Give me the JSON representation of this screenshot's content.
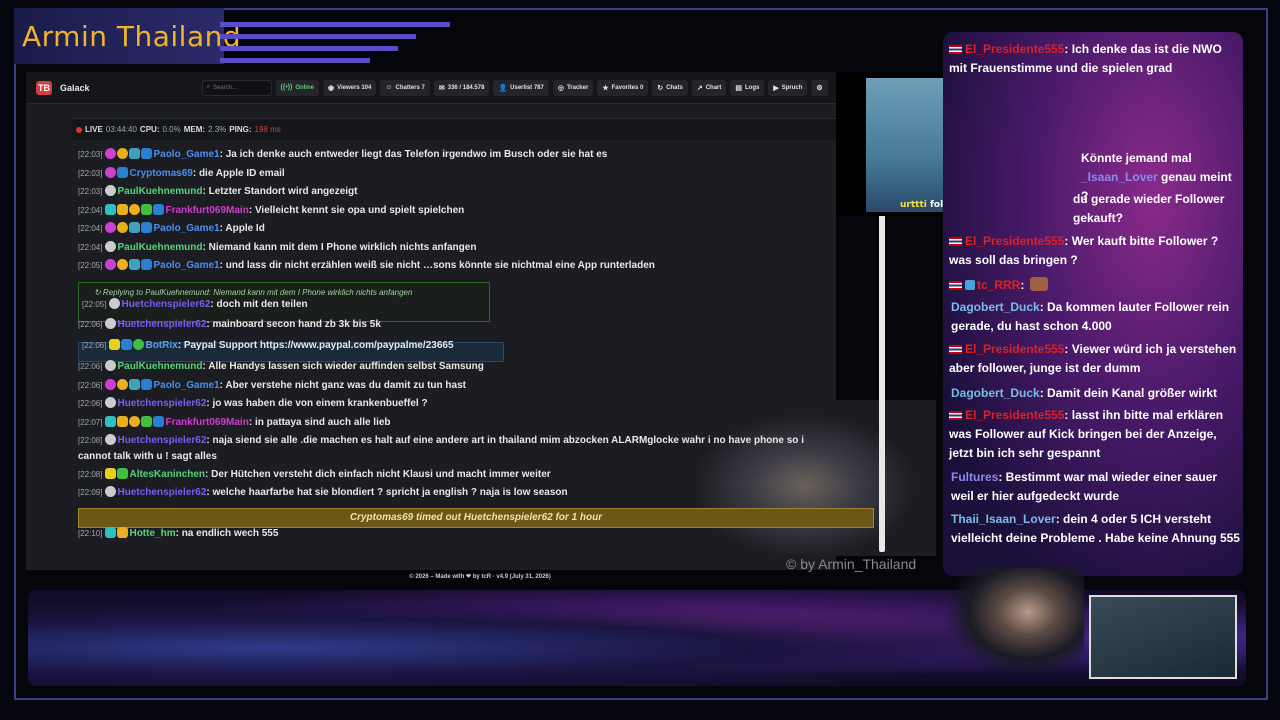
{
  "overlay": {
    "title": "Armin Thailand",
    "watermark": "© by Armin_Thailand",
    "footer": "© 2026 – Made with ❤ by tcR · v4.9 (July 31, 2026)"
  },
  "app": {
    "logo": "TB",
    "name": "Galack",
    "search_placeholder": "Search...",
    "nav": [
      {
        "icon": "online-icon",
        "glyph": "((•))",
        "label": "Online"
      },
      {
        "icon": "eye-icon",
        "glyph": "◉",
        "label": "Viewers 104"
      },
      {
        "icon": "chatters-icon",
        "glyph": "☺",
        "label": "Chatters 7"
      },
      {
        "icon": "message-icon",
        "glyph": "✉",
        "label": "336 / 184.578"
      },
      {
        "icon": "user-icon",
        "glyph": "👤",
        "label": "Userlist 787"
      },
      {
        "icon": "tracker-icon",
        "glyph": "◎",
        "label": "Tracker"
      },
      {
        "icon": "star-icon",
        "glyph": "★",
        "label": "Favorites 0"
      },
      {
        "icon": "history-icon",
        "glyph": "↻",
        "label": "Chats"
      },
      {
        "icon": "chart-icon",
        "glyph": "↗",
        "label": "Chart"
      },
      {
        "icon": "logs-icon",
        "glyph": "▤",
        "label": "Logs"
      },
      {
        "icon": "spruch-icon",
        "glyph": "▶",
        "label": "Spruch"
      },
      {
        "icon": "gear-icon",
        "glyph": "⚙",
        "label": ""
      }
    ],
    "status": {
      "live": "LIVE",
      "uptime": "03:44:40",
      "cpu_label": "CPU:",
      "cpu": "0.0%",
      "mem_label": "MEM:",
      "mem": "2.3%",
      "ping_label": "PING:",
      "ping": "198 ms"
    }
  },
  "chat": [
    {
      "time": "[22:03]",
      "user": "Paolo_Game1",
      "text": "Ja ich denke auch entweder liegt das Telefon irgendwo im Busch oder sie hat es"
    },
    {
      "time": "[22:03]",
      "user": "Cryptomas69",
      "text": "die Apple ID email"
    },
    {
      "time": "[22:03]",
      "user": "PaulKuehnemund",
      "text": "Letzter Standort wird angezeigt"
    },
    {
      "time": "[22:04]",
      "user": "Frankfurt069Main",
      "text": "Vielleicht kennt sie opa und spielt spielchen"
    },
    {
      "time": "[22:04]",
      "user": "Paolo_Game1",
      "text": "Apple Id"
    },
    {
      "time": "[22:04]",
      "user": "PaulKuehnemund",
      "text": "Niemand kann mit dem I Phone wirklich nichts anfangen"
    },
    {
      "time": "[22:05]",
      "user": "Paolo_Game1",
      "text": "und lass dir nicht erzählen weiß sie nicht …sons könnte sie nichtmal eine App runterladen"
    },
    {
      "reply": "Replying to PaulKuehnemund: Niemand kann mit dem I Phone wirklich nichts anfangen"
    },
    {
      "time": "[22:05]",
      "user": "Huetchenspieler62",
      "text": "doch mit den teilen"
    },
    {
      "time": "[22:06]",
      "user": "Huetchenspieler62",
      "text": "mainboard secon hand zb 3k bis 5k"
    },
    {
      "time": "[22:06]",
      "user": "BotRix",
      "text": "Paypal Support https://www.paypal.com/paypalme/23665"
    },
    {
      "time": "[22:06]",
      "user": "PaulKuehnemund",
      "text": "Alle Handys lassen sich wieder auffinden selbst Samsung"
    },
    {
      "time": "[22:06]",
      "user": "Paolo_Game1",
      "text": "Aber verstehe nicht ganz was du damit zu tun hast"
    },
    {
      "time": "[22:06]",
      "user": "Huetchenspieler62",
      "text": "jo was haben die von einem krankenbueffel ?"
    },
    {
      "time": "[22:07]",
      "user": "Frankfurt069Main",
      "text": "in pattaya sind auch alle lieb"
    },
    {
      "time": "[22:08]",
      "user": "Huetchenspieler62",
      "text": "naja siend sie alle .die machen es halt auf eine andere art in thailand mim abzocken ALARMglocke wahr i no have phone so i",
      "text2": "cannot talk with u ! sagt alles"
    },
    {
      "time": "[22:08]",
      "user": "AltesKaninchen",
      "text": "Der Hütchen versteht dich einfach nicht Klausi und macht immer weiter"
    },
    {
      "time": "[22:09]",
      "user": "Huetchenspieler62",
      "text": "welche haarfarbe hat sie blondiert ? spricht ja english ? naja is low season"
    },
    {
      "notice": "Cryptomas69 timed out Huetchenspieler62 for 1 hour"
    },
    {
      "time": "[22:10]",
      "user": "Hotte_hm",
      "text": "na endlich wech 555"
    }
  ],
  "video": {
    "caption_user": "urttti",
    "caption_text": " folgt dem Kanal!"
  },
  "side_chat": [
    {
      "user": "El_Presidente555",
      "text": ": Ich denke das ist die NWO mit Frauenstimme und die spielen grad"
    },
    {
      "user": "",
      "text": "Könnte jemand mal"
    },
    {
      "user": "_Isaan_Lover",
      "text": " genau meint ?"
    },
    {
      "user": "",
      "text": "du gerade wieder Follower gekauft?"
    },
    {
      "user": "El_Presidente555",
      "text": ": Wer kauft bitte Follower ? was soll das bringen ?"
    },
    {
      "user": "tc_RRR",
      "text": ":"
    },
    {
      "user": "Dagobert_Duck",
      "text": ": Da kommen lauter Follower rein gerade, du hast schon 4.000"
    },
    {
      "user": "El_Presidente555",
      "text": ": Viewer würd ich ja verstehen aber follower, junge ist der dumm"
    },
    {
      "user": "Dagobert_Duck",
      "text": ": Damit dein Kanal größer wirkt"
    },
    {
      "user": "El_Presidente555",
      "text": ": lasst ihn bitte mal erklären was Follower auf Kick bringen bei der Anzeige, jetzt bin ich sehr gespannt"
    },
    {
      "user": "Fultures",
      "text": ": Bestimmt war mal wieder einer sauer weil er hier aufgedeckt wurde"
    },
    {
      "user": "Thaii_Isaan_Lover",
      "text": ": dein 4 oder 5 ICH versteht vielleicht deine Probleme . Habe keine Ahnung 555"
    }
  ]
}
